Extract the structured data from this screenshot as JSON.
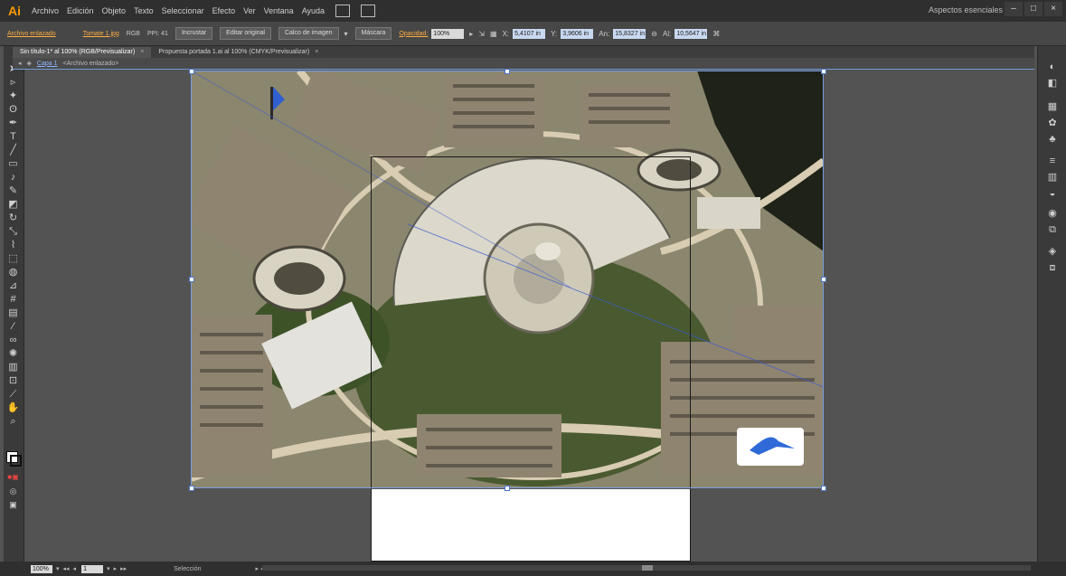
{
  "app": {
    "logo": "Ai"
  },
  "menu": [
    "Archivo",
    "Edición",
    "Objeto",
    "Texto",
    "Seleccionar",
    "Efecto",
    "Ver",
    "Ventana",
    "Ayuda"
  ],
  "workspace": "Aspectos esenciales",
  "window_controls": {
    "minimize": "–",
    "restore": "□",
    "close": "×"
  },
  "control_bar": {
    "linked_file": "Archivo enlazado",
    "filename": "Tomate 1.jpg",
    "color_mode": "RGB",
    "ppi": "PPI: 41",
    "embed": "Incrustar",
    "edit_original": "Editar original",
    "image_trace": "Calco de imagen",
    "mask": "Máscara",
    "opacity_label": "Opacidad:",
    "opacity_value": "100%",
    "x_value": "5,4107 in",
    "y_value": "3,9606 in",
    "w_value": "15,8327 in",
    "h_value": "10,5647 in"
  },
  "tabs": [
    {
      "label": "Sin título-1* al 100% (RGB/Previsualizar)",
      "active": true
    },
    {
      "label": "Propuesta portada 1.ai al 100% (CMYK/Previsualizar)",
      "active": false
    }
  ],
  "breadcrumb": {
    "layer": "Capa 1",
    "object": "<Archivo enlazado>"
  },
  "status": {
    "zoom": "100%",
    "page": "1",
    "tool": "Selección"
  },
  "colors": {
    "accent": "#ff9a00",
    "selection": "#4a74c9",
    "panel": "#3a3a3a",
    "canvas": "#535353"
  },
  "icons": {
    "tools": [
      "selection-tool-icon",
      "direct-selection-tool-icon",
      "magic-wand-icon",
      "lasso-icon",
      "pen-icon",
      "type-icon",
      "line-icon",
      "rectangle-icon",
      "brush-icon",
      "pencil-icon",
      "eraser-icon",
      "rotate-icon",
      "scale-icon",
      "warp-icon",
      "free-transform-icon",
      "shape-builder-icon",
      "perspective-icon",
      "mesh-icon",
      "gradient-icon",
      "eyedropper-icon",
      "blend-icon",
      "symbol-sprayer-icon",
      "graph-icon",
      "artboard-icon",
      "slice-icon",
      "hand-icon",
      "zoom-icon"
    ],
    "panels": [
      "color-icon",
      "color-guide-icon",
      "swatches-icon",
      "brushes-icon",
      "symbols-icon",
      "stroke-icon",
      "gradient-icon",
      "transparency-icon",
      "appearance-icon",
      "graphic-styles-icon",
      "layers-icon",
      "artboards-icon"
    ]
  }
}
